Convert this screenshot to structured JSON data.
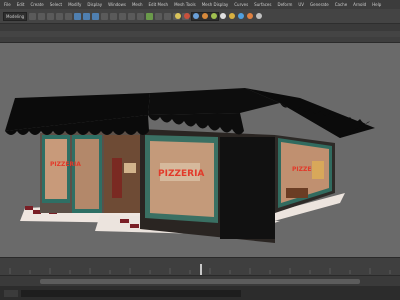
{
  "menubar": {
    "items": [
      "File",
      "Edit",
      "Create",
      "Select",
      "Modify",
      "Display",
      "Windows",
      "Mesh",
      "Edit Mesh",
      "Mesh Tools",
      "Mesh Display",
      "Curves",
      "Surfaces",
      "Deform",
      "UV",
      "Generate",
      "Cache",
      "Arnold",
      "Help"
    ]
  },
  "statusline": {
    "mode_select": "Modeling",
    "icons": [
      "select-tool-icon",
      "lasso-tool-icon",
      "paint-select-icon",
      "move-tool-icon",
      "rotate-tool-icon",
      "scale-tool-icon",
      "snap-grid-icon",
      "snap-curve-icon",
      "snap-point-icon",
      "snap-plane-icon",
      "render-icon",
      "ipr-render-icon",
      "render-settings-icon",
      "hypershade-icon",
      "light-icon"
    ]
  },
  "viewport": {
    "sign_left": "PIZZERIA",
    "sign_front": "PIZZERIA",
    "sign_right": "PIZZERIA"
  },
  "colors": {
    "viewport_bg": "#6a6a6a",
    "awning": "#0c0c0c",
    "window_frame": "#3a6e63",
    "sign_text": "#e23a2a",
    "interior": "#b87a55"
  }
}
